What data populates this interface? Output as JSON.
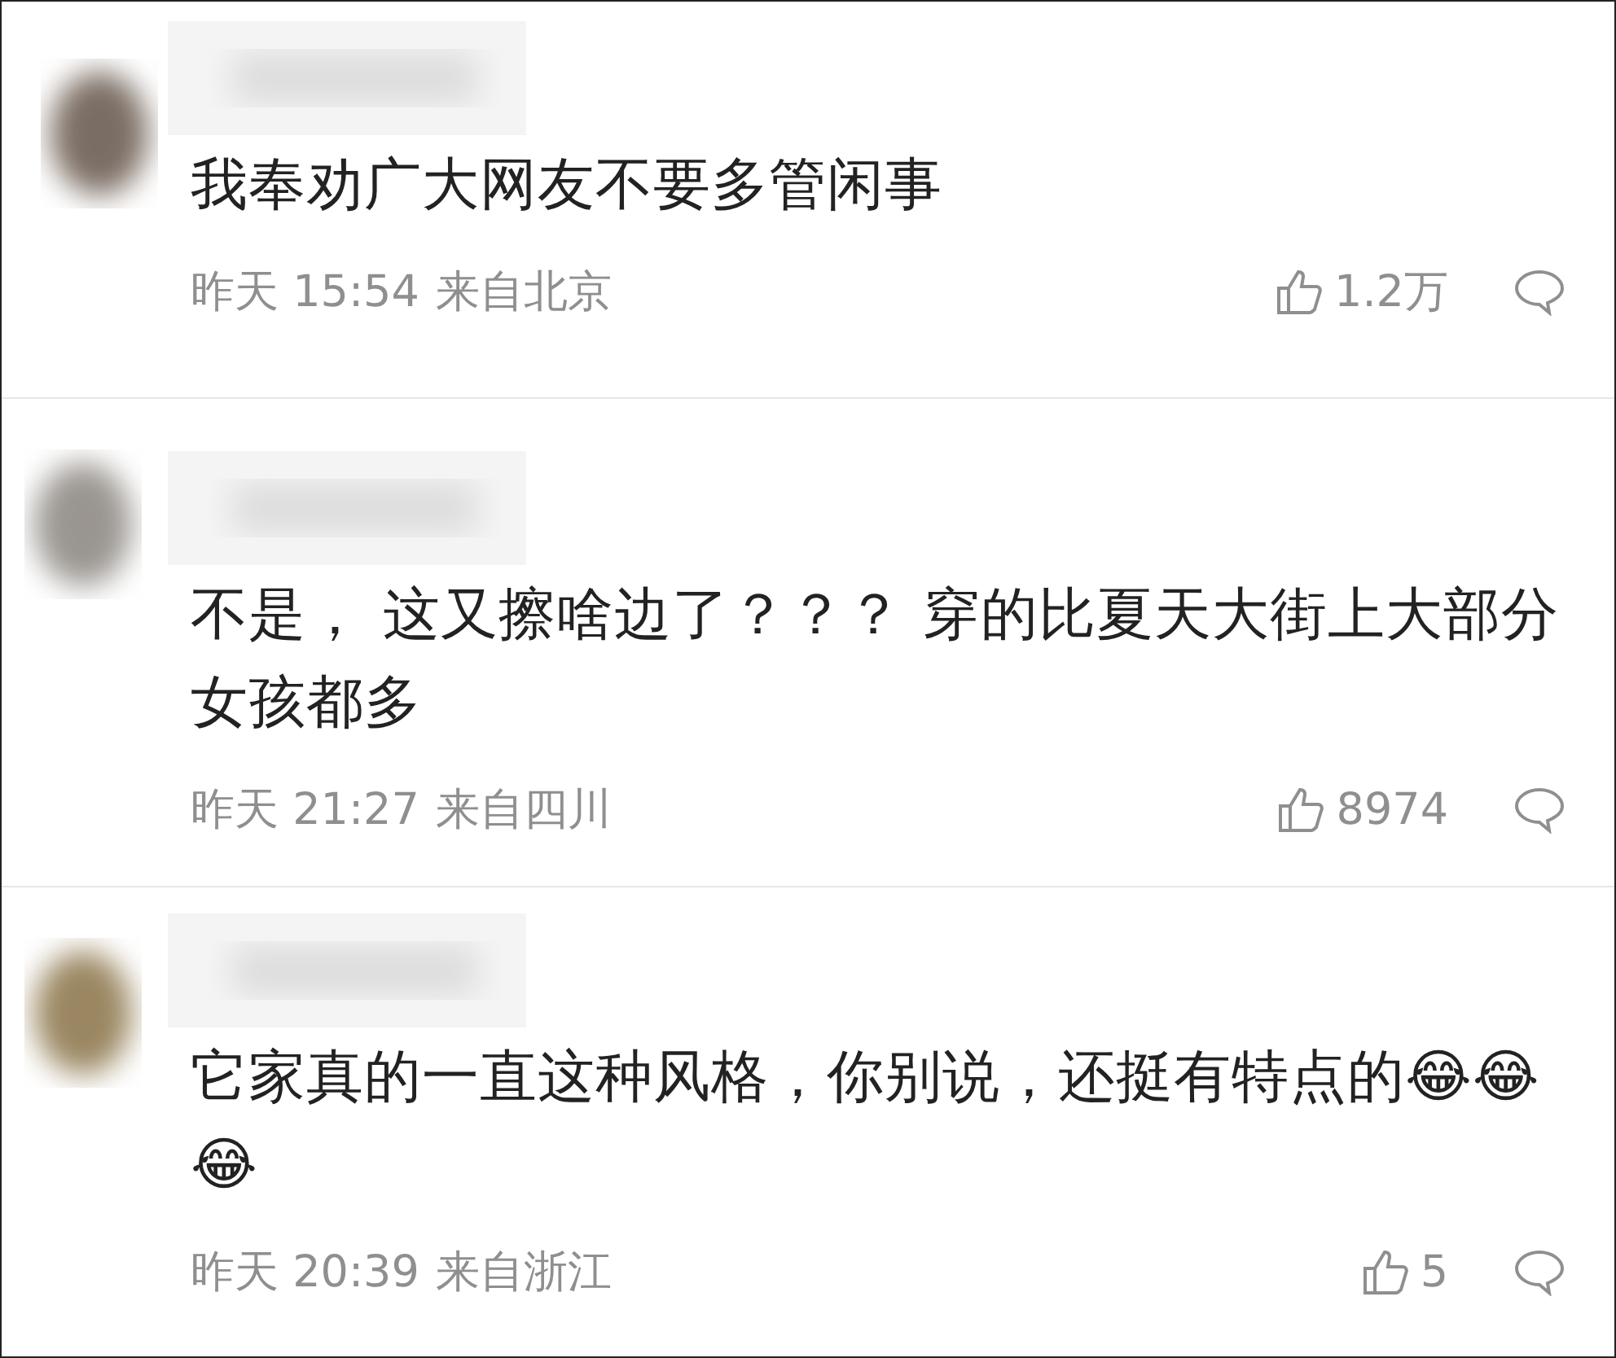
{
  "comments": [
    {
      "text": "我奉劝广大网友不要多管闲事",
      "time": "昨天 15:54",
      "location": "来自北京",
      "likes": "1.2万"
    },
    {
      "text": "不是， 这又擦啥边了？？？ 穿的比夏天大街上大部分女孩都多",
      "time": "昨天 21:27",
      "location": "来自四川",
      "likes": "8974"
    },
    {
      "text": "它家真的一直这种风格，你别说，还挺有特点的😂😂😂",
      "time": "昨天 20:39",
      "location": "来自浙江",
      "likes": "5"
    }
  ]
}
